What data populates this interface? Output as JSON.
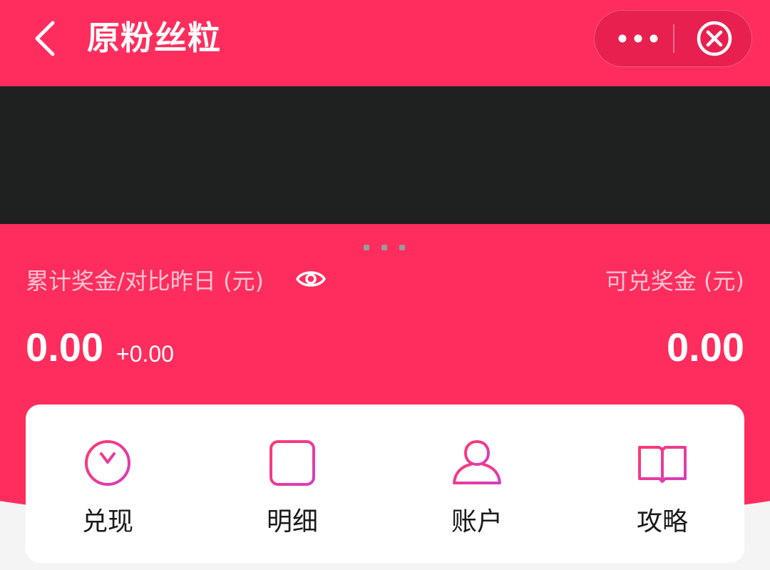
{
  "header": {
    "title": "原粉丝粒",
    "back_icon": "chevron-left-icon",
    "more_icon": "more-dots-icon",
    "close_icon": "close-circle-icon"
  },
  "stats": {
    "total_label": "累计奖金/对比昨日 (元)",
    "total_value": "0.00",
    "delta_value": "+0.00",
    "redeemable_label": "可兑奖金 (元)",
    "redeemable_value": "0.00",
    "visibility_icon": "eye-icon"
  },
  "actions": [
    {
      "label": "兑现",
      "icon": "yuan-circle-icon"
    },
    {
      "label": "明细",
      "icon": "document-list-icon"
    },
    {
      "label": "账户",
      "icon": "user-icon"
    },
    {
      "label": "攻略",
      "icon": "open-book-icon"
    }
  ],
  "colors": {
    "brand": "#fe2d5d",
    "capsule": "#e8204f",
    "video_bg": "#1f2120",
    "icon_gradient_start": "#fe2d5d",
    "icon_gradient_end": "#d63cc0"
  }
}
